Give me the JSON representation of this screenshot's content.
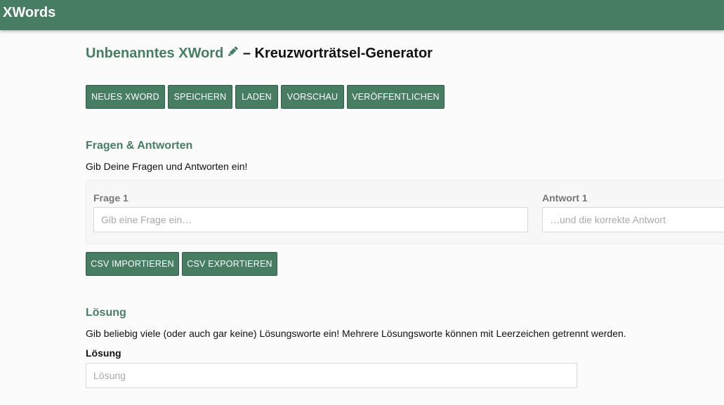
{
  "navbar": {
    "brand": "XWords"
  },
  "header": {
    "xword_name": "Unbenanntes XWord",
    "subtitle": "– Kreuzworträtsel-Generator",
    "edit_icon": "pencil-icon"
  },
  "toolbar": {
    "new_label": "Neues XWord",
    "save_label": "Speichern",
    "load_label": "Laden",
    "preview_label": "Vorschau",
    "publish_label": "Veröffentlichen"
  },
  "qa_section": {
    "title": "Fragen & Antworten",
    "description": "Gib Deine Fragen und Antworten ein!",
    "items": [
      {
        "question_label": "Frage 1",
        "question_placeholder": "Gib eine Frage ein…",
        "question_value": "",
        "answer_label": "Antwort 1",
        "answer_placeholder": "…und die korrekte Antwort",
        "answer_value": ""
      }
    ],
    "csv_import_label": "CSV importieren",
    "csv_export_label": "CSV exportieren"
  },
  "solution_section": {
    "title": "Lösung",
    "description": "Gib beliebig viele (oder auch gar keine) Lösungsworte ein! Mehrere Lösungsworte können mit Leerzeichen getrennt werden.",
    "field_label": "Lösung",
    "placeholder": "Lösung",
    "value": ""
  },
  "colors": {
    "accent": "#477d63",
    "accent_border": "#2f5c46",
    "background": "#fbfbfb"
  }
}
